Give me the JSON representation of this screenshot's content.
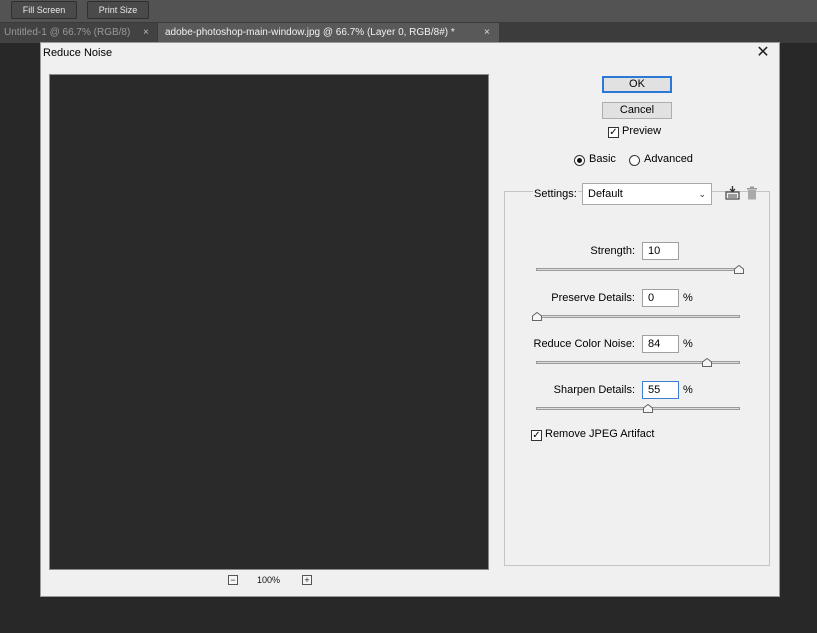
{
  "options_bar": {
    "fill_screen_label": "Fill Screen",
    "print_size_label": "Print Size"
  },
  "document_tabs": [
    {
      "title": "Untitled-1 @ 66.7% (RGB/8)",
      "close": "×"
    },
    {
      "title": "adobe-photoshop-main-window.jpg @ 66.7% (Layer 0, RGB/8#) *",
      "close": "×"
    }
  ],
  "dialog": {
    "title": "Reduce Noise",
    "close": "✕",
    "ok_label": "OK",
    "cancel_label": "Cancel",
    "preview": {
      "label": "Preview",
      "checked": true
    },
    "mode": {
      "basic_label": "Basic",
      "advanced_label": "Advanced",
      "selected": "Basic"
    },
    "zoom": {
      "minus": "−",
      "level": "100%",
      "plus": "+"
    },
    "settings": {
      "label": "Settings:",
      "value": "Default",
      "save_icon": "save-settings-icon",
      "delete_icon": "trash-icon"
    },
    "sliders": [
      {
        "label": "Strength:",
        "value": "10",
        "unit": "",
        "fraction": 1.0
      },
      {
        "label": "Preserve Details:",
        "value": "0",
        "unit": "%",
        "fraction": 0.0
      },
      {
        "label": "Reduce Color Noise:",
        "value": "84",
        "unit": "%",
        "fraction": 0.84
      },
      {
        "label": "Sharpen Details:",
        "value": "55",
        "unit": "%",
        "fraction": 0.55
      }
    ],
    "remove_jpeg": {
      "label": "Remove JPEG Artifact",
      "checked": true
    }
  },
  "colors": {
    "workspace": "#282828",
    "dialog_bg": "#f0f0f0",
    "ok_border": "#2b79d6",
    "preview_bg": "#2a2a2a"
  }
}
